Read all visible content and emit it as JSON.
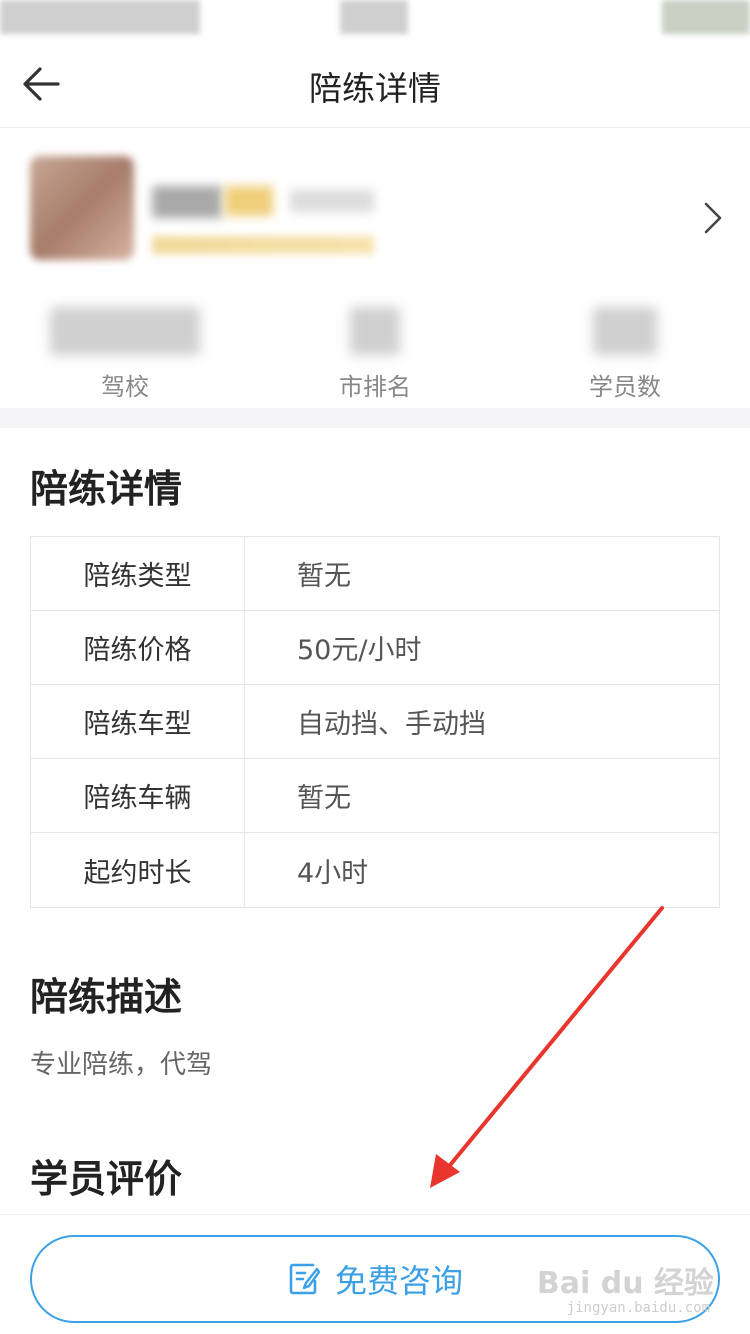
{
  "nav": {
    "title": "陪练详情"
  },
  "stats": [
    {
      "label": "驾校"
    },
    {
      "label": "市排名"
    },
    {
      "label": "学员数"
    }
  ],
  "detail_section": {
    "title": "陪练详情",
    "rows": [
      {
        "key": "陪练类型",
        "value": "暂无"
      },
      {
        "key": "陪练价格",
        "value": "50元/小时"
      },
      {
        "key": "陪练车型",
        "value": "自动挡、手动挡"
      },
      {
        "key": "陪练车辆",
        "value": "暂无"
      },
      {
        "key": "起约时长",
        "value": "4小时"
      }
    ]
  },
  "description_section": {
    "title": "陪练描述",
    "text": "专业陪练，代驾"
  },
  "reviews_section": {
    "title": "学员评价"
  },
  "bottom_bar": {
    "consult_label": "免费咨询"
  },
  "watermark": {
    "brand": "Bai du 经验",
    "url": "jingyan.baidu.com"
  },
  "colors": {
    "accent": "#3ca0e6",
    "arrow": "#e8352d"
  }
}
